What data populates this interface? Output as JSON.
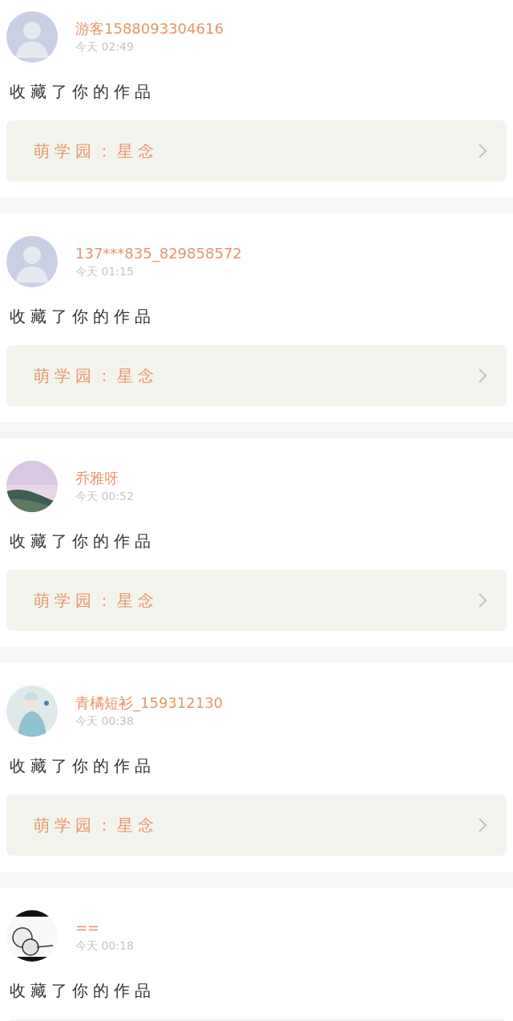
{
  "notifications": [
    {
      "user": {
        "name": "游客1588093304616",
        "avatar": {
          "kind": "silhouette"
        }
      },
      "time": "今天 02:49",
      "action": "收藏了你的作品",
      "work": {
        "kind": "link",
        "title": "萌学园：星念"
      }
    },
    {
      "user": {
        "name": "137***835_829858572",
        "avatar": {
          "kind": "silhouette"
        }
      },
      "time": "今天 01:15",
      "action": "收藏了你的作品",
      "work": {
        "kind": "link",
        "title": "萌学园：星念"
      }
    },
    {
      "user": {
        "name": "乔雅呀"
      },
      "time": "今天 00:52",
      "action": "收藏了你的作品",
      "work": {
        "kind": "link",
        "title": "萌学园：星念"
      }
    },
    {
      "user": {
        "name": "青橘短衫_159312130"
      },
      "time": "今天 00:38",
      "action": "收藏了你的作品",
      "work": {
        "kind": "link",
        "title": "萌学园：星念"
      }
    },
    {
      "user": {
        "name": "=="
      },
      "time": "今天 00:18",
      "action": "收藏了你的作品",
      "work": {
        "kind": "cut"
      }
    }
  ]
}
